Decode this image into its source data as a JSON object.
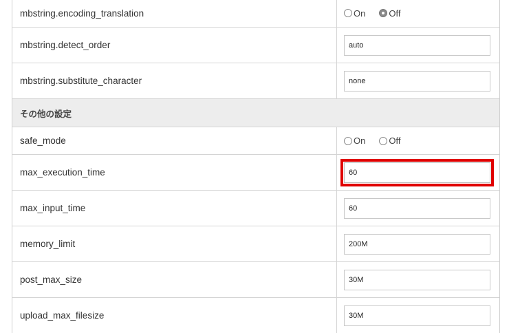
{
  "rows_top": [
    {
      "label": "mbstring.encoding_translation",
      "type": "radio",
      "on_label": "On",
      "off_label": "Off",
      "selected": "Off"
    },
    {
      "label": "mbstring.detect_order",
      "type": "text",
      "value": "auto"
    },
    {
      "label": "mbstring.substitute_character",
      "type": "text",
      "value": "none"
    }
  ],
  "section": {
    "title": "その他の設定"
  },
  "rows_bottom": [
    {
      "label": "safe_mode",
      "type": "radio",
      "on_label": "On",
      "off_label": "Off",
      "selected": ""
    },
    {
      "label": "max_execution_time",
      "type": "text",
      "value": "60",
      "highlighted": true
    },
    {
      "label": "max_input_time",
      "type": "text",
      "value": "60"
    },
    {
      "label": "memory_limit",
      "type": "text",
      "value": "200M"
    },
    {
      "label": "post_max_size",
      "type": "text",
      "value": "30M"
    },
    {
      "label": "upload_max_filesize",
      "type": "text",
      "value": "30M"
    }
  ],
  "colors": {
    "highlight": "#e00000",
    "section_bg": "#ededed"
  }
}
